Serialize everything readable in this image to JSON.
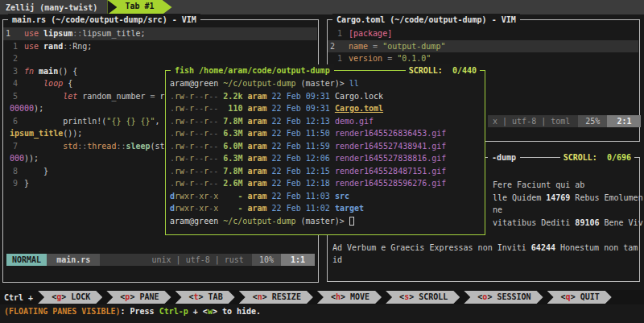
{
  "topbar": {
    "session": "Zellij (many-twist) ",
    "tab": "Tab #1"
  },
  "left_pane": {
    "title": "main.rs (~/code/output-dump/src) - VIM",
    "lines": [
      {
        "g": "1",
        "cur": true,
        "s": [
          [
            "kwu",
            "use"
          ],
          [
            "pl",
            " "
          ],
          [
            "b",
            "lipsum"
          ],
          [
            "pu",
            "::"
          ],
          [
            "pl",
            "lipsum_title;"
          ]
        ]
      },
      {
        "g": "1",
        "s": [
          [
            "kwu",
            "use"
          ],
          [
            "pl",
            " "
          ],
          [
            "b",
            "rand"
          ],
          [
            "pu",
            "::"
          ],
          [
            "pl",
            "Rng;"
          ]
        ]
      },
      {
        "g": "2",
        "s": []
      },
      {
        "g": "3",
        "s": [
          [
            "kwi",
            "fn"
          ],
          [
            "pl",
            " "
          ],
          [
            "b",
            "main"
          ],
          [
            "pl",
            "() {"
          ]
        ]
      },
      {
        "g": "4",
        "s": [
          [
            "pl",
            "    "
          ],
          [
            "kwi",
            "loop"
          ],
          [
            "pl",
            " {"
          ]
        ]
      },
      {
        "g": "5",
        "s": [
          [
            "pl",
            "        "
          ],
          [
            "kwi",
            "let"
          ],
          [
            "pl",
            " random_number "
          ],
          [
            "pu",
            "="
          ],
          [
            "pl",
            " r"
          ]
        ]
      },
      {
        "wrap": true,
        "s": [
          [
            "num",
            "00000"
          ],
          [
            "pl",
            ");"
          ]
        ]
      },
      {
        "g": "6",
        "s": [
          [
            "pl",
            "        println!("
          ],
          [
            "str",
            "\"{} {} {}\""
          ],
          [
            "pl",
            ","
          ]
        ]
      },
      {
        "wrap": true,
        "s": [
          [
            "fy",
            "ipsum_title"
          ],
          [
            "pl",
            "());"
          ]
        ]
      },
      {
        "g": "7",
        "s": [
          [
            "pl",
            "        "
          ],
          [
            "org",
            "std"
          ],
          [
            "pu",
            "::"
          ],
          [
            "org",
            "thread"
          ],
          [
            "pu",
            "::"
          ],
          [
            "tealb",
            "sleep"
          ],
          [
            "pl",
            "(st"
          ]
        ]
      },
      {
        "wrap": true,
        "s": [
          [
            "num",
            "000"
          ],
          [
            "pl",
            "));"
          ]
        ]
      },
      {
        "g": "8",
        "s": [
          [
            "pl",
            "    }"
          ]
        ]
      },
      {
        "g": "9",
        "s": [
          [
            "pl",
            "}"
          ]
        ]
      }
    ],
    "statusline": {
      "mode": "NORMAL",
      "file": "main.rs",
      "meta": "unix | utf-8 | rust",
      "percent": "10%",
      "position": "1:1"
    }
  },
  "right_top_pane": {
    "title": "Cargo.toml (~/code/output-dump) - VIM",
    "lines": [
      {
        "g": "1",
        "s": [
          [
            "pink",
            "[package]"
          ]
        ]
      },
      {
        "g": "2",
        "cur": true,
        "s": [
          [
            "org",
            "name"
          ],
          [
            "pu",
            " = "
          ],
          [
            "str",
            "\"output-dump\""
          ]
        ]
      },
      {
        "g": "1",
        "s": [
          [
            "org",
            "version"
          ],
          [
            "pu",
            " = "
          ],
          [
            "str",
            "\"0.1.0\""
          ]
        ]
      }
    ],
    "statusline": {
      "meta": "x | utf-8 | toml",
      "percent": "25%",
      "position": "2:1"
    }
  },
  "right_bottom_pane": {
    "title_fragment": "-dump",
    "scroll_label": "SCROLL:",
    "scroll_value": "0/696",
    "lines": [
      {
        "s": [
          [
            "pl",
            "Fere Faciunt qui ab"
          ]
        ]
      },
      {
        "s": [
          [
            "pl",
            "lle Quidem "
          ],
          [
            "b",
            "14769"
          ],
          [
            "pl",
            " Rebus Emolumen"
          ]
        ]
      },
      {
        "s": [
          [
            "pl",
            "ne"
          ]
        ]
      },
      {
        "s": [
          [
            "pl",
            "vitatibus Dediti "
          ],
          [
            "b",
            "89106"
          ],
          [
            "pl",
            " Bene Viv"
          ]
        ]
      },
      {
        "s": [
          [
            "pl",
            "Ad Verbum e Graecis Expressas non Inviti "
          ],
          [
            "b",
            "64244"
          ],
          [
            "pl",
            " Honestum non tam"
          ]
        ]
      },
      {
        "s": [
          [
            "pl",
            "id"
          ]
        ]
      }
    ]
  },
  "float_pane": {
    "title": "fish /home/aram/code/output-dump",
    "scroll_label": "SCROLL:",
    "scroll_value": "0/440",
    "lines": [
      {
        "s": [
          [
            "white",
            "aram@green"
          ],
          [
            "pl",
            " "
          ],
          [
            "path",
            "~/c/output-dump"
          ],
          [
            "pl",
            " (master)> "
          ],
          [
            "blue",
            "ll"
          ]
        ]
      },
      {
        "s": [
          [
            "permstr",
            ".rw-r--r--"
          ],
          [
            "pl",
            " "
          ],
          [
            "sizeg",
            "2.2k"
          ],
          [
            "pl",
            " "
          ],
          [
            "fy",
            "aram"
          ],
          [
            "pl",
            " "
          ],
          [
            "blue",
            "22 Feb 09:31"
          ],
          [
            "pl",
            " "
          ],
          [
            "white",
            "Cargo.lock"
          ]
        ]
      },
      {
        "s": [
          [
            "permstr",
            ".rw-r--r--"
          ],
          [
            "pl",
            " "
          ],
          [
            "sizeg",
            " 110"
          ],
          [
            "pl",
            " "
          ],
          [
            "fy",
            "aram"
          ],
          [
            "pl",
            " "
          ],
          [
            "blue",
            "22 Feb 09:31"
          ],
          [
            "pl",
            " "
          ],
          [
            "undy",
            "Cargo.toml"
          ]
        ]
      },
      {
        "s": [
          [
            "permstr",
            ".rw-r--r--"
          ],
          [
            "pl",
            " "
          ],
          [
            "sizeg",
            "7.8M"
          ],
          [
            "pl",
            " "
          ],
          [
            "fy",
            "aram"
          ],
          [
            "pl",
            " "
          ],
          [
            "blue",
            "22 Feb 12:13"
          ],
          [
            "pl",
            " "
          ],
          [
            "gif",
            "demo.gif"
          ]
        ]
      },
      {
        "s": [
          [
            "permstr",
            ".rw-r--r--"
          ],
          [
            "pl",
            " "
          ],
          [
            "sizeg",
            "6.3M"
          ],
          [
            "pl",
            " "
          ],
          [
            "fy",
            "aram"
          ],
          [
            "pl",
            " "
          ],
          [
            "blue",
            "22 Feb 11:50"
          ],
          [
            "pl",
            " "
          ],
          [
            "gif",
            "render1645526836453.gif"
          ]
        ]
      },
      {
        "s": [
          [
            "permstr",
            ".rw-r--r--"
          ],
          [
            "pl",
            " "
          ],
          [
            "sizeg",
            "6.0M"
          ],
          [
            "pl",
            " "
          ],
          [
            "fy",
            "aram"
          ],
          [
            "pl",
            " "
          ],
          [
            "blue",
            "22 Feb 11:59"
          ],
          [
            "pl",
            " "
          ],
          [
            "gif",
            "render1645527438941.gif"
          ]
        ]
      },
      {
        "s": [
          [
            "permstr",
            ".rw-r--r--"
          ],
          [
            "pl",
            " "
          ],
          [
            "sizeg",
            "6.3M"
          ],
          [
            "pl",
            " "
          ],
          [
            "fy",
            "aram"
          ],
          [
            "pl",
            " "
          ],
          [
            "blue",
            "22 Feb 12:06"
          ],
          [
            "pl",
            " "
          ],
          [
            "gif",
            "render1645527838816.gif"
          ]
        ]
      },
      {
        "s": [
          [
            "permstr",
            ".rw-r--r--"
          ],
          [
            "pl",
            " "
          ],
          [
            "sizeg",
            "7.8M"
          ],
          [
            "pl",
            " "
          ],
          [
            "fy",
            "aram"
          ],
          [
            "pl",
            " "
          ],
          [
            "blue",
            "22 Feb 12:15"
          ],
          [
            "pl",
            " "
          ],
          [
            "gif",
            "render1645528487151.gif"
          ]
        ]
      },
      {
        "s": [
          [
            "permstr",
            ".rw-r--r--"
          ],
          [
            "pl",
            " "
          ],
          [
            "sizeg",
            "2.6M"
          ],
          [
            "pl",
            " "
          ],
          [
            "fy",
            "aram"
          ],
          [
            "pl",
            " "
          ],
          [
            "blue",
            "22 Feb 12:18"
          ],
          [
            "pl",
            " "
          ],
          [
            "gif",
            "render1645528596276.gif"
          ]
        ]
      },
      {
        "s": [
          [
            "permstr",
            "drwxr-xr-x"
          ],
          [
            "pl",
            " "
          ],
          [
            "sizeg",
            "   -"
          ],
          [
            "pl",
            " "
          ],
          [
            "fy",
            "aram"
          ],
          [
            "pl",
            " "
          ],
          [
            "blue",
            "22 Feb 11:03"
          ],
          [
            "pl",
            " "
          ],
          [
            "dirb",
            "src"
          ]
        ]
      },
      {
        "s": [
          [
            "permstr",
            "drwxr-xr-x"
          ],
          [
            "pl",
            " "
          ],
          [
            "sizeg",
            "   -"
          ],
          [
            "pl",
            " "
          ],
          [
            "fy",
            "aram"
          ],
          [
            "pl",
            " "
          ],
          [
            "blue",
            "22 Feb 11:02"
          ],
          [
            "pl",
            " "
          ],
          [
            "dirb",
            "target"
          ]
        ]
      },
      {
        "s": [
          [
            "white",
            "aram@green"
          ],
          [
            "pl",
            " "
          ],
          [
            "path",
            "~/c/output-dump"
          ],
          [
            "pl",
            " (master)> "
          ],
          [
            "curbox",
            ""
          ]
        ]
      }
    ]
  },
  "keybar": {
    "prefix": "Ctrl +",
    "items": [
      {
        "key": "g",
        "label": "LOCK"
      },
      {
        "key": "p",
        "label": "PANE"
      },
      {
        "key": "t",
        "label": "TAB"
      },
      {
        "key": "n",
        "label": "RESIZE"
      },
      {
        "key": "h",
        "label": "MOVE"
      },
      {
        "key": "s",
        "label": "SCROLL"
      },
      {
        "key": "o",
        "label": "SESSION"
      },
      {
        "key": "q",
        "label": "QUIT"
      }
    ]
  },
  "helpline": {
    "parts": [
      [
        "orange",
        "(FLOATING PANES VISIBLE)"
      ],
      [
        "w",
        ": Press "
      ],
      [
        "green",
        "Ctrl-p"
      ],
      [
        "w",
        " + <"
      ],
      [
        "green",
        "w"
      ],
      [
        "w",
        "> to hide."
      ]
    ]
  }
}
